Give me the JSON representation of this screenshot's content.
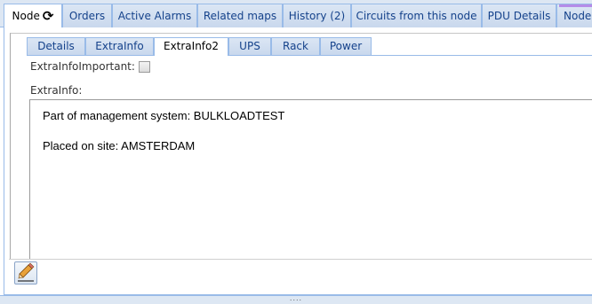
{
  "outer_tabs": [
    {
      "label": "Node",
      "active": true
    },
    {
      "label": "Orders"
    },
    {
      "label": "Active Alarms"
    },
    {
      "label": "Related maps"
    },
    {
      "label": "History (2)"
    },
    {
      "label": "Circuits from this node"
    },
    {
      "label": "PDU Details"
    },
    {
      "label": "Node"
    }
  ],
  "inner_tabs": [
    {
      "label": "Details"
    },
    {
      "label": "ExtraInfo"
    },
    {
      "label": "ExtraInfo2",
      "active": true
    },
    {
      "label": "UPS"
    },
    {
      "label": "Rack"
    },
    {
      "label": "Power"
    }
  ],
  "form": {
    "important_label": "ExtraInfoImportant:",
    "important_checked": false,
    "extrainfo_label": "ExtraInfo:",
    "extrainfo_lines": [
      "Part of management system: BULKLOADTEST",
      "Placed on site: AMSTERDAM"
    ]
  },
  "icons": {
    "refresh": "refresh-icon",
    "edit": "pencil-icon"
  },
  "colors": {
    "tab_border": "#99bbe8",
    "tab_text": "#15428b",
    "accent_bar": "#b58ce8"
  }
}
